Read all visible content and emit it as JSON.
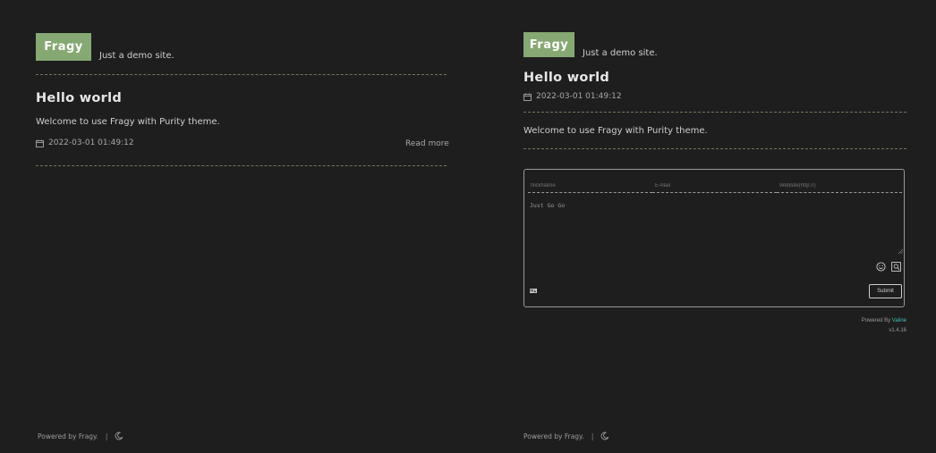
{
  "left": {
    "header": {
      "logo": "Fragy",
      "tagline": "Just a demo site."
    },
    "post": {
      "title": "Hello world",
      "excerpt": "Welcome to use Fragy with Purity theme.",
      "date": "2022-03-01 01:49:12",
      "read_more": "Read more"
    },
    "footer": {
      "powered": "Powered by Fragy.",
      "separator": "|"
    }
  },
  "right": {
    "header": {
      "logo": "Fragy",
      "tagline": "Just a demo site."
    },
    "post": {
      "title": "Hello world",
      "date": "2022-03-01 01:49:12",
      "content": "Welcome to use Fragy with Purity theme."
    },
    "comments": {
      "nick_placeholder": "NickName",
      "email_placeholder": "E-Mail",
      "website_placeholder": "Website(http://)",
      "textarea_value": "Just Go Go",
      "submit_label": "Submit",
      "powered_prefix": "Powered By ",
      "powered_brand": "Valine",
      "version": "v1.4.16"
    },
    "footer": {
      "powered": "Powered by Fragy.",
      "separator": "|"
    }
  },
  "colors": {
    "accent": "#86a872",
    "background": "#1e1e1e",
    "valine_brand": "#3ec1b4"
  },
  "icons": [
    "calendar-icon",
    "moon-icon",
    "emoji-icon",
    "preview-icon",
    "markdown-icon"
  ]
}
